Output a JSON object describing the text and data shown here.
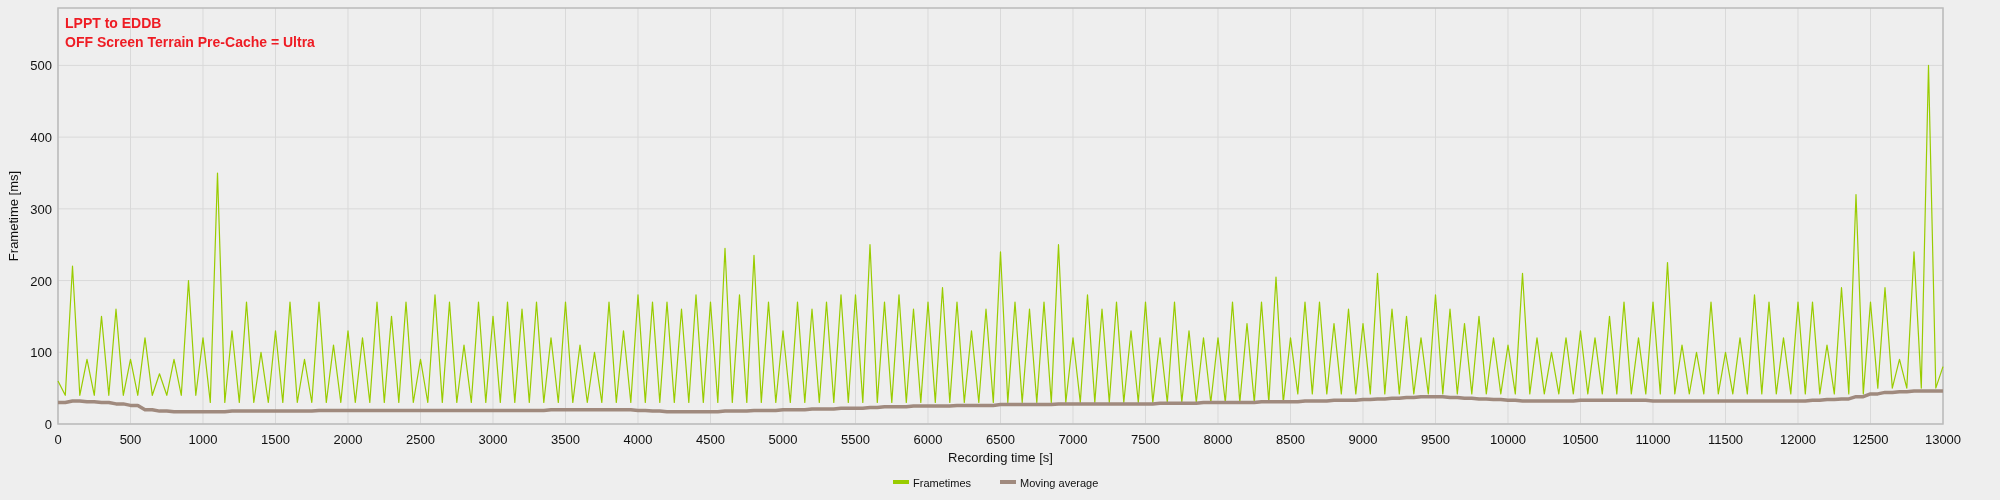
{
  "chart_data": {
    "type": "line",
    "title": [
      "LPPT to EDDB",
      "OFF Screen Terrain Pre-Cache = Ultra"
    ],
    "xlabel": "Recording time [s]",
    "ylabel": "Frametime [ms]",
    "grid": true,
    "legend": true,
    "xlim": [
      0,
      13000
    ],
    "ylim": [
      0,
      580
    ],
    "xticks": [
      0,
      500,
      1000,
      1500,
      2000,
      2500,
      3000,
      3500,
      4000,
      4500,
      5000,
      5500,
      6000,
      6500,
      7000,
      7500,
      8000,
      8500,
      9000,
      9500,
      10000,
      10500,
      11000,
      11500,
      12000,
      12500,
      13000
    ],
    "yticks": [
      0,
      100,
      200,
      300,
      400,
      500
    ],
    "x": [
      0,
      50,
      100,
      150,
      200,
      250,
      300,
      350,
      400,
      450,
      500,
      550,
      600,
      650,
      700,
      750,
      800,
      850,
      900,
      950,
      1000,
      1050,
      1100,
      1150,
      1200,
      1250,
      1300,
      1350,
      1400,
      1450,
      1500,
      1550,
      1600,
      1650,
      1700,
      1750,
      1800,
      1850,
      1900,
      1950,
      2000,
      2050,
      2100,
      2150,
      2200,
      2250,
      2300,
      2350,
      2400,
      2450,
      2500,
      2550,
      2600,
      2650,
      2700,
      2750,
      2800,
      2850,
      2900,
      2950,
      3000,
      3050,
      3100,
      3150,
      3200,
      3250,
      3300,
      3350,
      3400,
      3450,
      3500,
      3550,
      3600,
      3650,
      3700,
      3750,
      3800,
      3850,
      3900,
      3950,
      4000,
      4050,
      4100,
      4150,
      4200,
      4250,
      4300,
      4350,
      4400,
      4450,
      4500,
      4550,
      4600,
      4650,
      4700,
      4750,
      4800,
      4850,
      4900,
      4950,
      5000,
      5050,
      5100,
      5150,
      5200,
      5250,
      5300,
      5350,
      5400,
      5450,
      5500,
      5550,
      5600,
      5650,
      5700,
      5750,
      5800,
      5850,
      5900,
      5950,
      6000,
      6050,
      6100,
      6150,
      6200,
      6250,
      6300,
      6350,
      6400,
      6450,
      6500,
      6550,
      6600,
      6650,
      6700,
      6750,
      6800,
      6850,
      6900,
      6950,
      7000,
      7050,
      7100,
      7150,
      7200,
      7250,
      7300,
      7350,
      7400,
      7450,
      7500,
      7550,
      7600,
      7650,
      7700,
      7750,
      7800,
      7850,
      7900,
      7950,
      8000,
      8050,
      8100,
      8150,
      8200,
      8250,
      8300,
      8350,
      8400,
      8450,
      8500,
      8550,
      8600,
      8650,
      8700,
      8750,
      8800,
      8850,
      8900,
      8950,
      9000,
      9050,
      9100,
      9150,
      9200,
      9250,
      9300,
      9350,
      9400,
      9450,
      9500,
      9550,
      9600,
      9650,
      9700,
      9750,
      9800,
      9850,
      9900,
      9950,
      10000,
      10050,
      10100,
      10150,
      10200,
      10250,
      10300,
      10350,
      10400,
      10450,
      10500,
      10550,
      10600,
      10650,
      10700,
      10750,
      10800,
      10850,
      10900,
      10950,
      11000,
      11050,
      11100,
      11150,
      11200,
      11250,
      11300,
      11350,
      11400,
      11450,
      11500,
      11550,
      11600,
      11650,
      11700,
      11750,
      11800,
      11850,
      11900,
      11950,
      12000,
      12050,
      12100,
      12150,
      12200,
      12250,
      12300,
      12350,
      12400,
      12450,
      12500,
      12550,
      12600,
      12650,
      12700,
      12750,
      12800,
      12850,
      12900,
      12950,
      13000
    ],
    "series": [
      {
        "name": "Frametimes",
        "color": "#99cc00",
        "values": [
          60,
          40,
          220,
          40,
          90,
          40,
          150,
          40,
          160,
          40,
          90,
          40,
          120,
          40,
          70,
          40,
          90,
          40,
          200,
          40,
          120,
          30,
          350,
          30,
          130,
          30,
          170,
          30,
          100,
          30,
          130,
          30,
          170,
          30,
          90,
          30,
          170,
          30,
          110,
          30,
          130,
          30,
          120,
          30,
          170,
          30,
          150,
          30,
          170,
          30,
          90,
          30,
          180,
          30,
          170,
          30,
          110,
          30,
          170,
          30,
          150,
          30,
          170,
          30,
          160,
          30,
          170,
          30,
          120,
          30,
          170,
          30,
          110,
          30,
          100,
          30,
          170,
          30,
          130,
          30,
          180,
          30,
          170,
          30,
          170,
          30,
          160,
          30,
          180,
          30,
          170,
          30,
          245,
          30,
          180,
          30,
          235,
          30,
          170,
          30,
          130,
          30,
          170,
          30,
          160,
          30,
          170,
          30,
          180,
          30,
          180,
          30,
          250,
          30,
          170,
          30,
          180,
          30,
          160,
          30,
          170,
          30,
          190,
          30,
          170,
          30,
          130,
          30,
          160,
          30,
          240,
          30,
          170,
          30,
          160,
          30,
          170,
          30,
          250,
          30,
          120,
          30,
          180,
          30,
          160,
          30,
          170,
          30,
          130,
          30,
          170,
          30,
          120,
          30,
          170,
          30,
          130,
          30,
          120,
          30,
          120,
          30,
          170,
          30,
          140,
          30,
          170,
          30,
          205,
          30,
          120,
          42,
          170,
          42,
          170,
          42,
          140,
          42,
          160,
          42,
          140,
          42,
          210,
          42,
          160,
          42,
          150,
          42,
          120,
          42,
          180,
          42,
          160,
          42,
          140,
          42,
          150,
          42,
          120,
          42,
          110,
          42,
          210,
          42,
          120,
          42,
          100,
          42,
          120,
          42,
          130,
          42,
          120,
          42,
          150,
          42,
          170,
          42,
          120,
          42,
          170,
          42,
          225,
          42,
          110,
          42,
          100,
          42,
          170,
          42,
          100,
          42,
          120,
          42,
          180,
          42,
          170,
          42,
          120,
          42,
          170,
          42,
          170,
          42,
          110,
          42,
          190,
          42,
          320,
          42,
          170,
          50,
          190,
          50,
          90,
          50,
          240,
          50,
          500,
          50,
          80
        ]
      },
      {
        "name": "Moving average",
        "color": "#a08a7e",
        "values": [
          30,
          30,
          32,
          32,
          31,
          31,
          30,
          30,
          28,
          28,
          26,
          26,
          20,
          20,
          18,
          18,
          17,
          17,
          17,
          17,
          17,
          17,
          17,
          17,
          18,
          18,
          18,
          18,
          18,
          18,
          18,
          18,
          18,
          18,
          18,
          18,
          19,
          19,
          19,
          19,
          19,
          19,
          19,
          19,
          19,
          19,
          19,
          19,
          19,
          19,
          19,
          19,
          19,
          19,
          19,
          19,
          19,
          19,
          19,
          19,
          19,
          19,
          19,
          19,
          19,
          19,
          19,
          19,
          20,
          20,
          20,
          20,
          20,
          20,
          20,
          20,
          20,
          20,
          20,
          20,
          19,
          19,
          18,
          18,
          17,
          17,
          17,
          17,
          17,
          17,
          17,
          17,
          18,
          18,
          18,
          18,
          19,
          19,
          19,
          19,
          20,
          20,
          20,
          20,
          21,
          21,
          21,
          21,
          22,
          22,
          22,
          22,
          23,
          23,
          24,
          24,
          24,
          24,
          25,
          25,
          25,
          25,
          25,
          25,
          26,
          26,
          26,
          26,
          26,
          26,
          27,
          27,
          27,
          27,
          27,
          27,
          27,
          27,
          28,
          28,
          28,
          28,
          28,
          28,
          28,
          28,
          28,
          28,
          28,
          28,
          28,
          28,
          29,
          29,
          29,
          29,
          29,
          29,
          30,
          30,
          30,
          30,
          30,
          30,
          30,
          30,
          31,
          31,
          31,
          31,
          31,
          31,
          32,
          32,
          32,
          32,
          33,
          33,
          33,
          33,
          34,
          34,
          35,
          35,
          36,
          36,
          37,
          37,
          38,
          38,
          38,
          38,
          37,
          37,
          36,
          36,
          35,
          35,
          34,
          34,
          33,
          33,
          32,
          32,
          32,
          32,
          32,
          32,
          32,
          32,
          33,
          33,
          33,
          33,
          33,
          33,
          33,
          33,
          33,
          33,
          32,
          32,
          32,
          32,
          32,
          32,
          32,
          32,
          32,
          32,
          32,
          32,
          32,
          32,
          32,
          32,
          32,
          32,
          32,
          32,
          32,
          32,
          33,
          33,
          34,
          34,
          35,
          35,
          38,
          38,
          42,
          42,
          44,
          44,
          45,
          45,
          46,
          46,
          46,
          46,
          46
        ]
      }
    ]
  }
}
